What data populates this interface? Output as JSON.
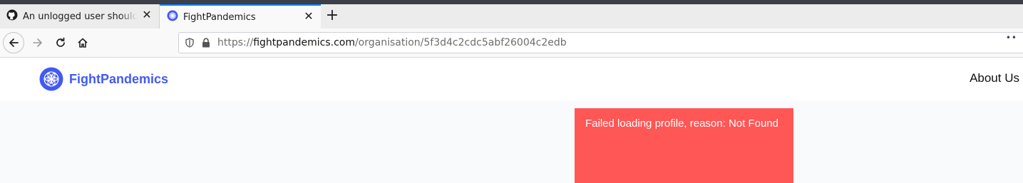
{
  "browser": {
    "tabs": [
      {
        "title": "An unlogged user should be able to see organisation profile",
        "favicon": "github-icon",
        "active": false
      },
      {
        "title": "FightPandemics",
        "favicon": "fightpandemics-icon",
        "active": true
      }
    ],
    "new_tab_icon": "plus-icon",
    "url": {
      "scheme": "https://",
      "domain": "fightpandemics.com",
      "path": "/organisation/5f3d4c2cdc5abf26004c2edb"
    },
    "more_icon": "ellipsis-icon"
  },
  "app": {
    "brand_name": "FightPandemics",
    "nav": {
      "about": "About Us"
    },
    "brand_color": "#425af2"
  },
  "error": {
    "message": "Failed loading profile, reason: Not Found",
    "color": "#ff5656"
  }
}
